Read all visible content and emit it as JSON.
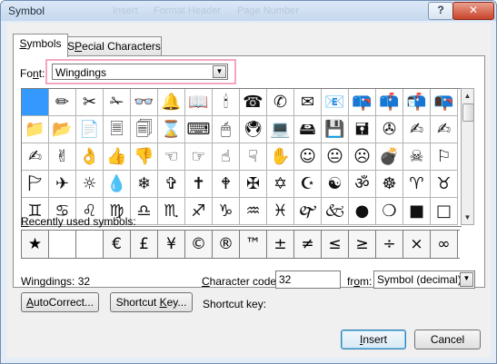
{
  "window": {
    "title": "Symbol",
    "background_titles": [
      "Insert",
      "Format Header",
      "Page Number"
    ],
    "help_label": "?",
    "close_label": "✕"
  },
  "tabs": [
    {
      "label": "Symbols",
      "underline": "S",
      "rest": "ymbols",
      "active": true
    },
    {
      "label": "Special Characters",
      "underline": "P",
      "before": "S",
      "rest": "ecial Characters",
      "active": false
    }
  ],
  "font": {
    "label_prefix": "Fo",
    "label_underline": "n",
    "label_suffix": "t:",
    "value": "Wingdings"
  },
  "symbols": [
    [
      "",
      "✏",
      "✂",
      "✁",
      "👓",
      "🔔",
      "📖",
      "🕯",
      "☎",
      "✆",
      "✉",
      "📧",
      "📪",
      "📫",
      "📬",
      "📭"
    ],
    [
      "📁",
      "📂",
      "📄",
      "🗏",
      "🗐",
      "⌛",
      "⌨",
      "🖱",
      "🖲",
      "💻",
      "🖴",
      "💾",
      "🖬",
      "✇",
      "✍",
      "✍"
    ],
    [
      "✍",
      "✌",
      "👌",
      "👍",
      "👎",
      "☜",
      "☞",
      "☝",
      "☟",
      "✋",
      "☺",
      "😐",
      "☹",
      "💣",
      "☠",
      "⚐"
    ],
    [
      "🏱",
      "✈",
      "☼",
      "💧",
      "❄",
      "✞",
      "✝",
      "🕈",
      "✠",
      "✡",
      "☪",
      "☯",
      "ॐ",
      "☸",
      "♈",
      "♉"
    ],
    [
      "♊",
      "♋",
      "♌",
      "♍",
      "♎",
      "♏",
      "♐",
      "♑",
      "♒",
      "♓",
      "🙰",
      "🙵",
      "●",
      "❍",
      "■",
      "□"
    ]
  ],
  "recent": {
    "label_prefix": "",
    "label_underline": "R",
    "label_suffix": "ecently used symbols:",
    "items": [
      "★",
      "",
      "",
      "€",
      "£",
      "¥",
      "©",
      "®",
      "™",
      "±",
      "≠",
      "≤",
      "≥",
      "÷",
      "×",
      "∞"
    ]
  },
  "status": {
    "text": "Wingdings: 32"
  },
  "char_code": {
    "label_prefix": "",
    "label_underline": "C",
    "label_suffix": "haracter code:",
    "value": "32"
  },
  "from": {
    "label_prefix": "fr",
    "label_underline": "o",
    "label_suffix": "m:",
    "value": "Symbol (decimal)"
  },
  "buttons": {
    "autocorrect": {
      "prefix": "",
      "underline": "A",
      "suffix": "utoCorrect..."
    },
    "shortcut": {
      "prefix": "Shortcut ",
      "underline": "K",
      "suffix": "ey..."
    },
    "insert": {
      "prefix": "",
      "underline": "I",
      "suffix": "nsert"
    },
    "cancel": "Cancel"
  },
  "shortcut_key_label": "Shortcut key:",
  "colors": {
    "selection": "#3399ff",
    "highlight": "#f2a6c4",
    "title_bar": "#c6d8ee",
    "close": "#c9432b"
  }
}
